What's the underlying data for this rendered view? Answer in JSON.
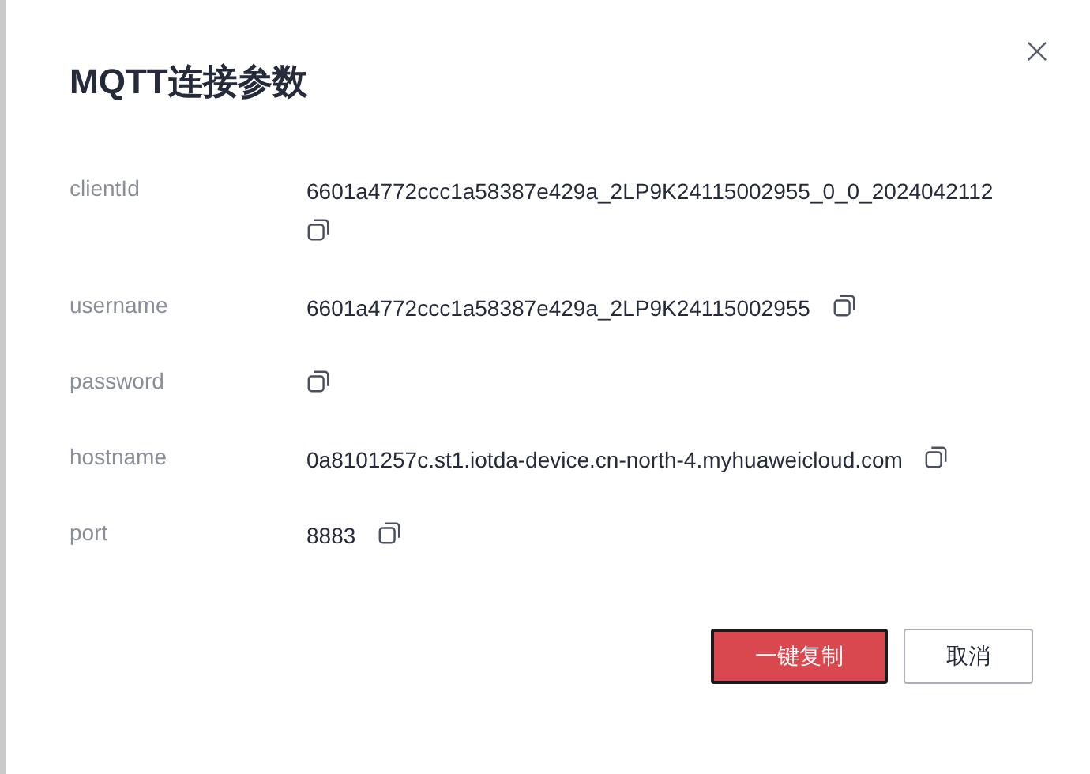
{
  "dialog": {
    "title": "MQTT连接参数",
    "params": [
      {
        "label": "clientId",
        "value": "6601a4772ccc1a58387e429a_2LP9K24115002955_0_0_2024042112"
      },
      {
        "label": "username",
        "value": "6601a4772ccc1a58387e429a_2LP9K24115002955"
      },
      {
        "label": "password"
      },
      {
        "label": "hostname",
        "value": "0a8101257c.st1.iotda-device.cn-north-4.myhuaweicloud.com"
      },
      {
        "label": "port",
        "value": "8883"
      }
    ],
    "buttons": [
      {
        "label": "一键复制",
        "kind": "primary"
      },
      {
        "label": "取消",
        "kind": "secondary"
      }
    ]
  }
}
